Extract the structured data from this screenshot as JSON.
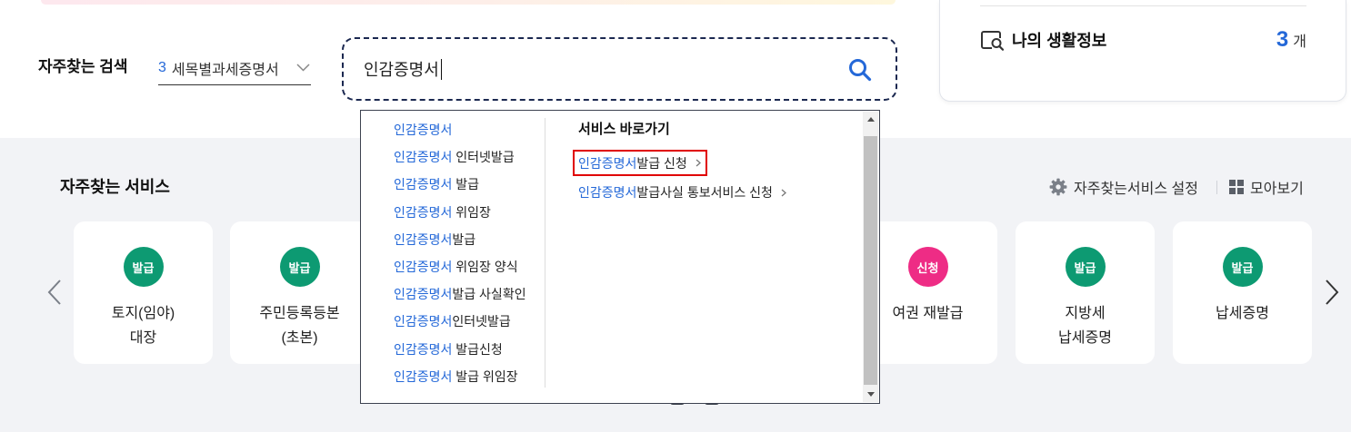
{
  "colors": {
    "accent": "#2468d8",
    "highlight_box": "#e00000",
    "section_bg": "#f2f3f6"
  },
  "quick_search": {
    "label": "자주찾는 검색",
    "rank": "3",
    "keyword": "세목별과세증명서",
    "icon": "chevron-down-icon"
  },
  "search": {
    "value": "인감증명서",
    "icon": "search-icon"
  },
  "life_info": {
    "icon": "document-search-icon",
    "label": "나의 생활정보",
    "count": "3",
    "unit": "개"
  },
  "autocomplete": {
    "suggestions": [
      {
        "match": "인감증명서"
      },
      {
        "match": "인감증명서",
        "rest": " 인터넷발급"
      },
      {
        "match": "인감증명서",
        "rest": " 발급"
      },
      {
        "match": "인감증명서",
        "rest": " 위임장"
      },
      {
        "match": "인감증명서",
        "rest": "발급"
      },
      {
        "match": "인감증명서",
        "rest": " 위임장 양식"
      },
      {
        "match": "인감증명서",
        "rest": "발급 사실확인"
      },
      {
        "match": "인감증명서",
        "rest": "인터넷발급"
      },
      {
        "match": "인감증명서",
        "rest": " 발급신청"
      },
      {
        "match": "인감증명서",
        "rest": " 발급 위임장"
      }
    ],
    "shortcut_title": "서비스 바로가기",
    "shortcuts": [
      {
        "match": "인감증명서",
        "rest": " 발급 신청",
        "highlighted": true
      },
      {
        "match": "인감증명서",
        "rest": " 발급사실 통보서비스 신청",
        "highlighted": false
      }
    ]
  },
  "services": {
    "title": "자주찾는 서비스",
    "settings_icon": "gear-icon",
    "settings_label": "자주찾는서비스 설정",
    "view_all_icon": "grid-icon",
    "view_all_label": "모아보기",
    "cards": [
      {
        "badge": "발급",
        "badge_color": "#0d9a72",
        "lines": [
          "토지(임야)",
          "대장"
        ]
      },
      {
        "badge": "발급",
        "badge_color": "#0d9a72",
        "lines": [
          "주민등록등본",
          "(초본)"
        ]
      },
      {
        "badge": "신청",
        "badge_color": "#ee2c85",
        "lines": [
          "여권 재발급"
        ]
      },
      {
        "badge": "발급",
        "badge_color": "#0d9a72",
        "lines": [
          "지방세",
          "납세증명"
        ]
      },
      {
        "badge": "발급",
        "badge_color": "#0d9a72",
        "lines": [
          "납세증명"
        ]
      }
    ]
  }
}
